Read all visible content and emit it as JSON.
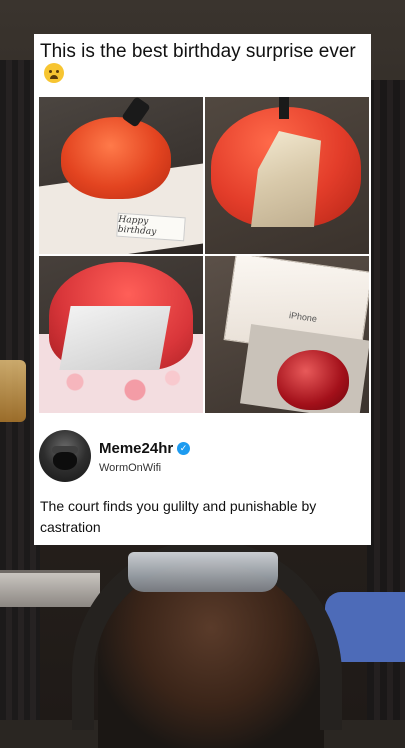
{
  "post": {
    "title": "This is the best  birthday surprise ever",
    "title_emoji": "loudly-crying-face-emoji",
    "images": [
      {
        "label": "Happy birthday"
      },
      {
        "label": ""
      },
      {
        "label": ""
      },
      {
        "label": "iPhone"
      }
    ],
    "account": {
      "name": "Meme24hr",
      "handle": "WormOnWifi",
      "verified_icon": "verified-badge-icon"
    },
    "caption": "The court finds you gulilty and punishable by castration"
  },
  "colors": {
    "card_bg": "#ffffff",
    "verified_blue": "#1d9bf0",
    "text": "#111111"
  }
}
